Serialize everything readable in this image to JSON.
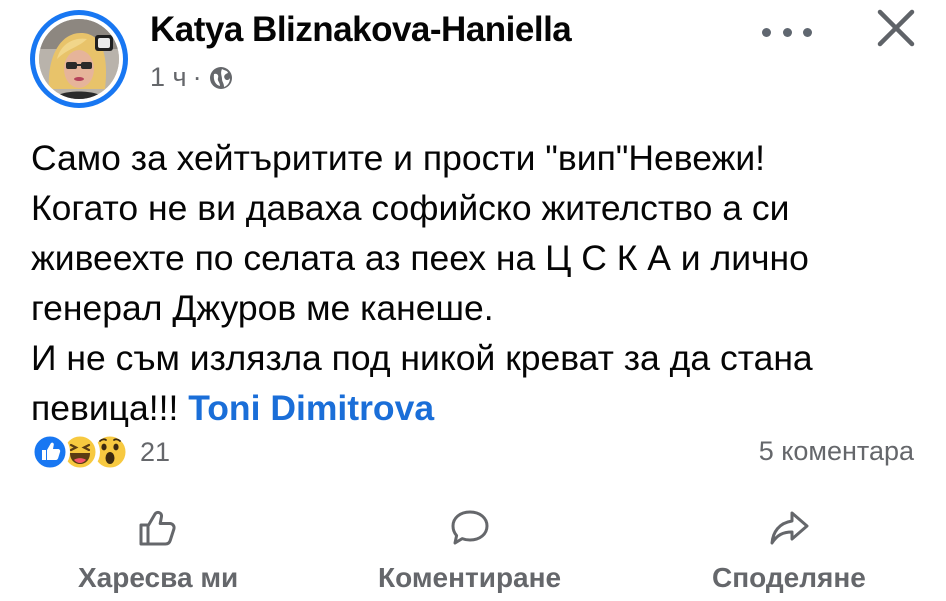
{
  "header": {
    "author_name": "Katya Bliznakova-Haniella",
    "timestamp": "1 ч",
    "separator": "·",
    "privacy_icon": "globe-icon",
    "more_icon": "more-horizontal-icon",
    "close_icon": "close-icon"
  },
  "post": {
    "lines": [
      "Само за хейтъритите и прости \"вип\"Невежи!",
      "Когато не ви даваха софийско жителство а си",
      "живеехте по селата аз пеех на Ц С К А и лично",
      "генерал Джуров ме канеше.",
      "И не съм излязла под никой креват за да стана"
    ],
    "last_line_text": "певица!!! ",
    "mention": "Toni Dimitrova"
  },
  "stats": {
    "reaction_icons": [
      "like-reaction-icon",
      "haha-reaction-icon",
      "wow-reaction-icon"
    ],
    "reaction_count": "21",
    "comments": "5 коментара"
  },
  "actions": {
    "like_label": "Харесва ми",
    "comment_label": "Коментиране",
    "share_label": "Споделяне"
  },
  "colors": {
    "accent": "#1877f2",
    "mention": "#1a6ed8",
    "secondary_text": "#65676b",
    "primary_text": "#050505",
    "haha_yellow": "#f7c940"
  }
}
